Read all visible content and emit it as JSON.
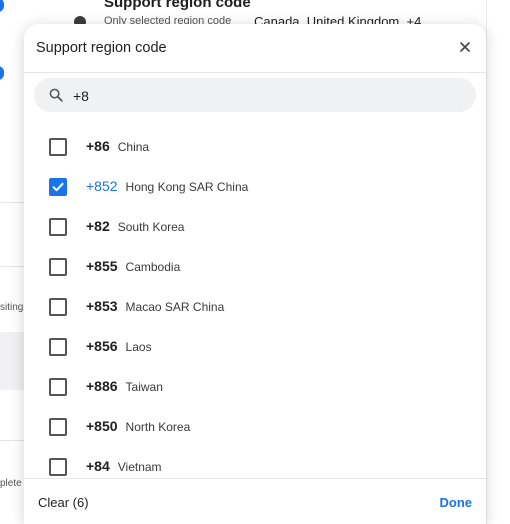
{
  "background": {
    "title": "Support region code",
    "subtitle": "Only selected region code",
    "value": "Canada, United Kingdom, +4",
    "side_text_1": "siting",
    "side_text_2": "plete"
  },
  "modal": {
    "title": "Support region code",
    "close_icon": "close-icon",
    "search": {
      "icon": "search-icon",
      "value": "+8",
      "placeholder": "Search"
    },
    "items": [
      {
        "code": "+86",
        "country": "China",
        "checked": false
      },
      {
        "code": "+852",
        "country": "Hong Kong SAR China",
        "checked": true
      },
      {
        "code": "+82",
        "country": "South Korea",
        "checked": false
      },
      {
        "code": "+855",
        "country": "Cambodia",
        "checked": false
      },
      {
        "code": "+853",
        "country": "Macao SAR China",
        "checked": false
      },
      {
        "code": "+856",
        "country": "Laos",
        "checked": false
      },
      {
        "code": "+886",
        "country": "Taiwan",
        "checked": false
      },
      {
        "code": "+850",
        "country": "North Korea",
        "checked": false
      },
      {
        "code": "+84",
        "country": "Vietnam",
        "checked": false
      }
    ],
    "footer": {
      "clear_label": "Clear (6)",
      "done_label": "Done"
    }
  },
  "colors": {
    "accent": "#1a73e8",
    "text": "#1f1f1f",
    "search_bg": "#f0f1f3"
  }
}
